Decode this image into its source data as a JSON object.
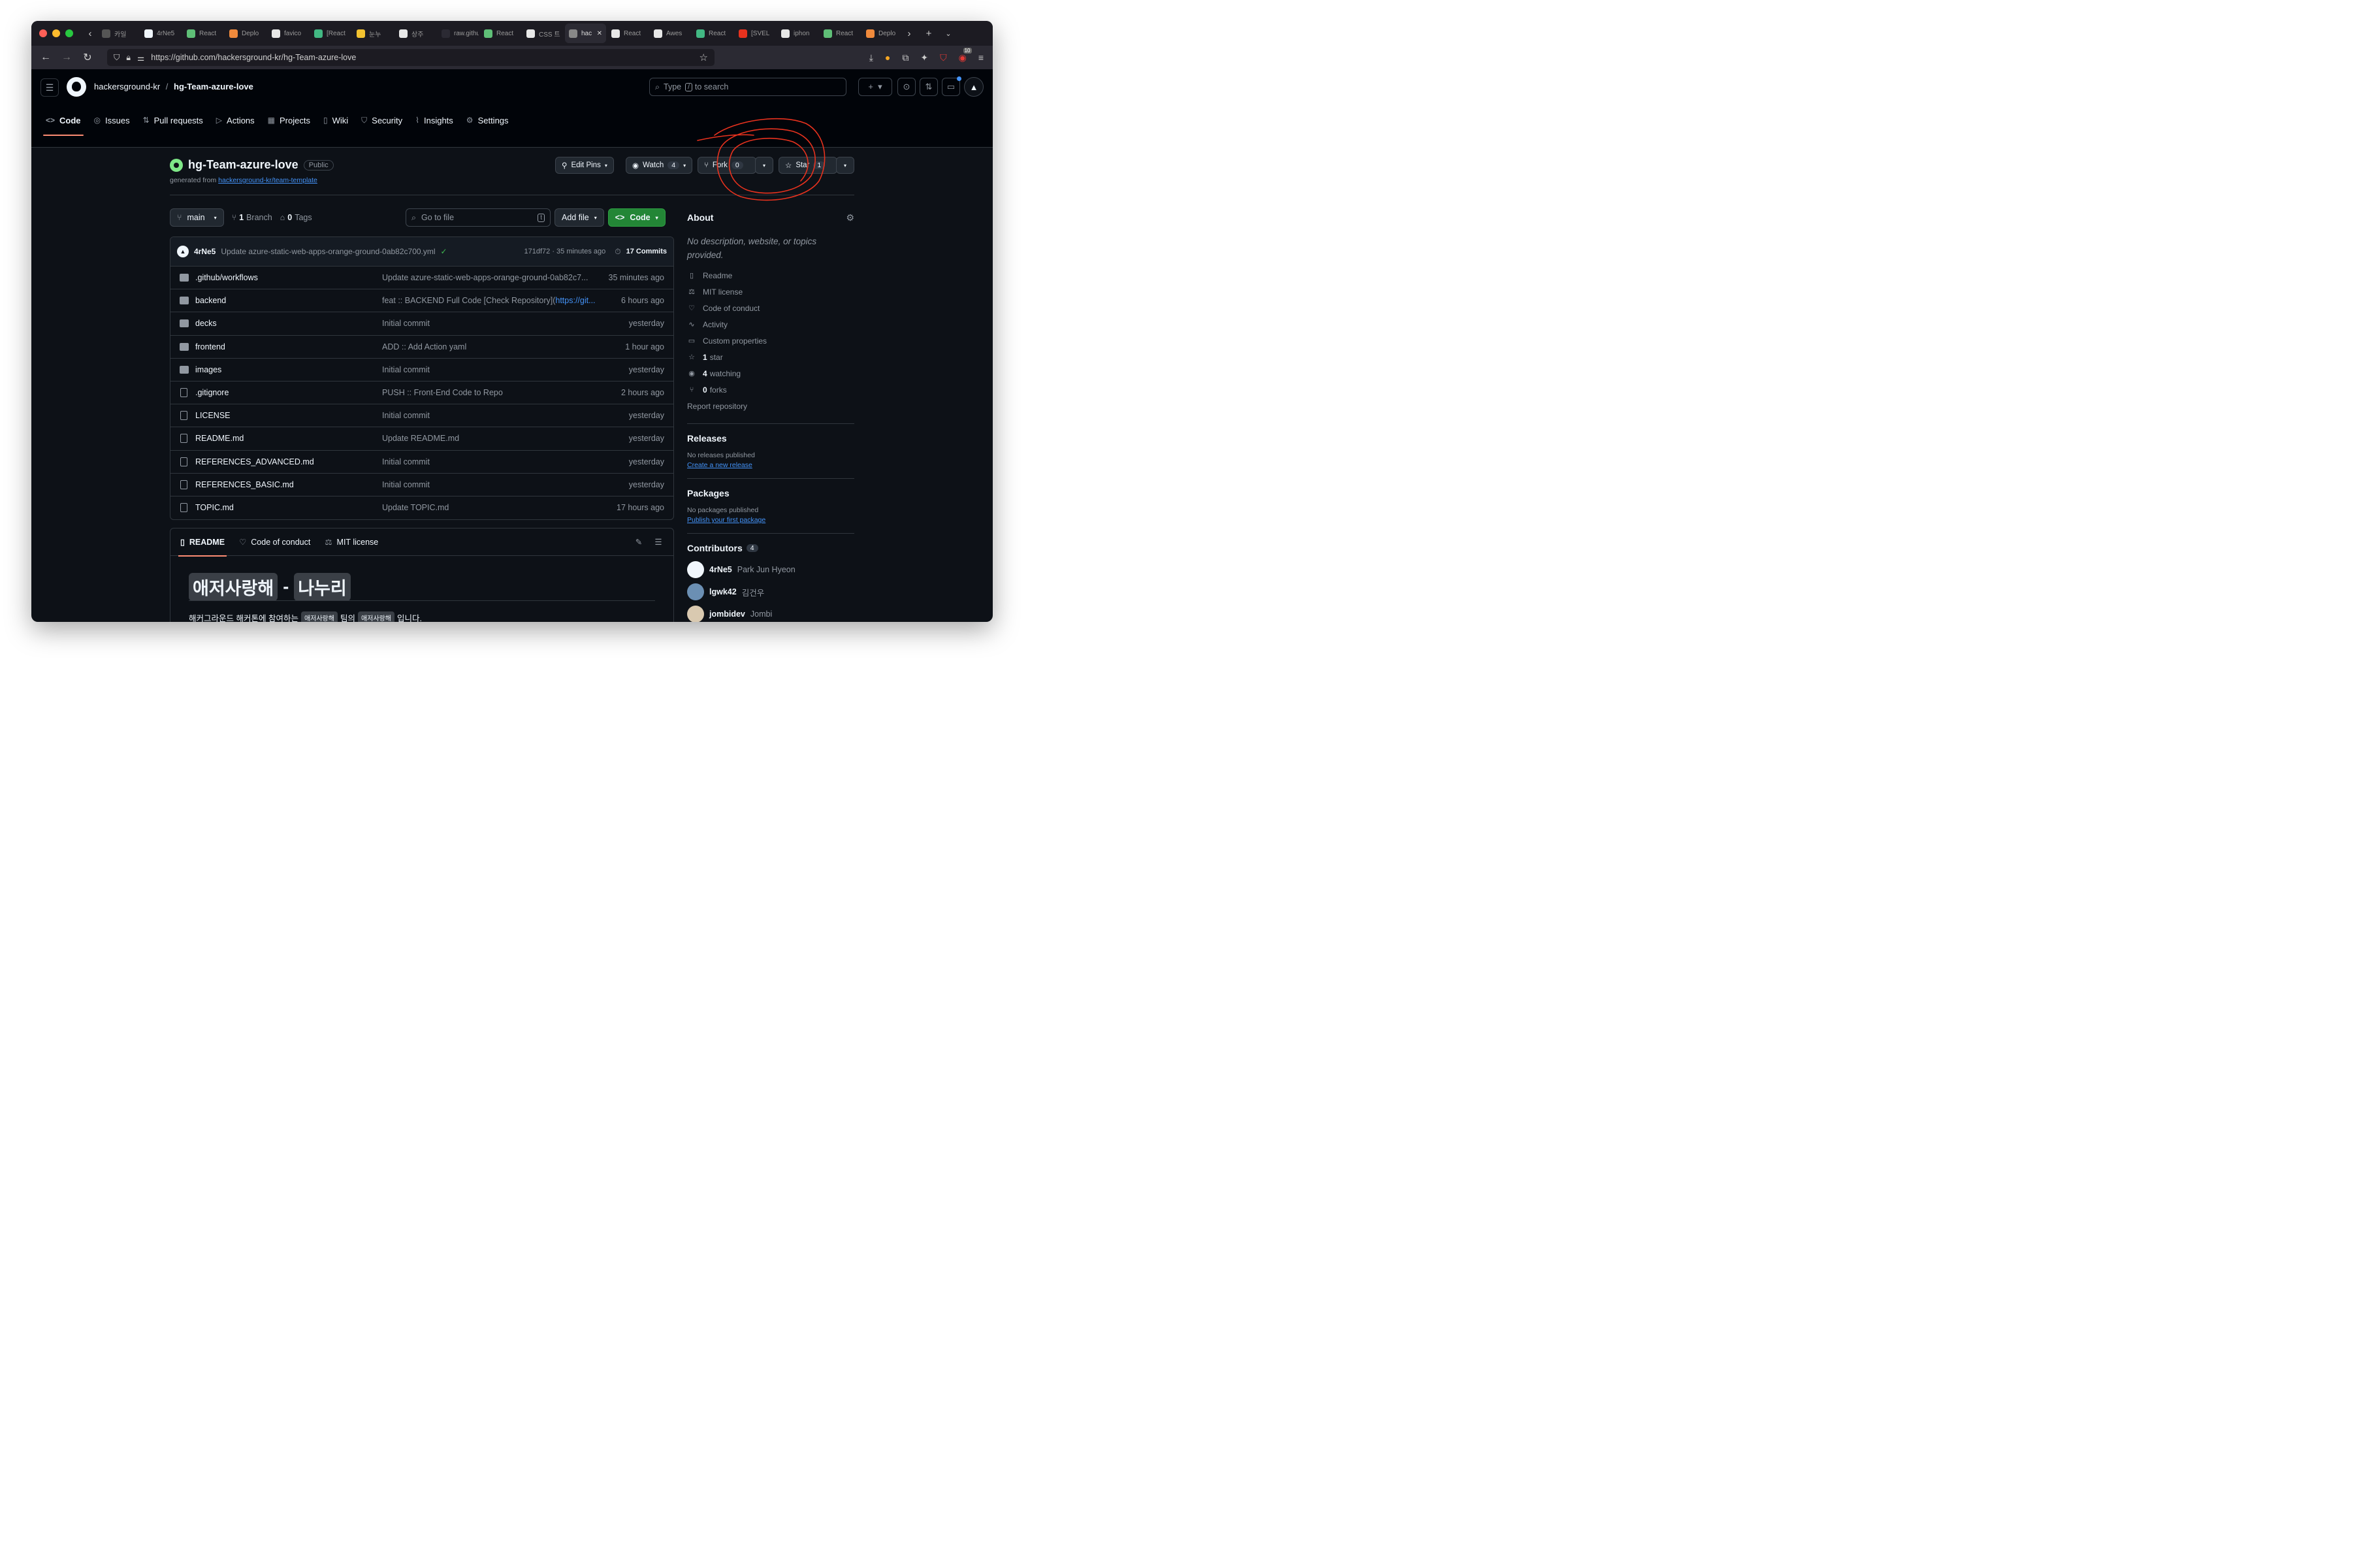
{
  "colors": {
    "accent_green": "#238636",
    "link_blue": "#4493f8",
    "annotation_red": "#e8321e",
    "tab_underline": "#fd8c73"
  },
  "browser": {
    "tabs": [
      {
        "label": "카일",
        "color": "#555"
      },
      {
        "label": "4rNe5",
        "color": "#f0f6fc"
      },
      {
        "label": "React",
        "color": "#5fbf77"
      },
      {
        "label": "Deplo",
        "color": "#f08a3c"
      },
      {
        "label": "favico",
        "color": "#e8e8e8"
      },
      {
        "label": "[React",
        "color": "#42b883"
      },
      {
        "label": "눈누",
        "color": "#f2c230"
      },
      {
        "label": "상주",
        "color": "#e8e8e8"
      },
      {
        "label": "raw.github",
        "color": "#2b2a33"
      },
      {
        "label": "React",
        "color": "#5fbf77"
      },
      {
        "label": "CSS 트",
        "color": "#e8e8e8"
      },
      {
        "label": "hac",
        "color": "#888"
      },
      {
        "label": "React",
        "color": "#e8e8e8"
      },
      {
        "label": "Awes",
        "color": "#e8e8e8"
      },
      {
        "label": "React",
        "color": "#42b883"
      },
      {
        "label": "[SVEL",
        "color": "#e8321e"
      },
      {
        "label": "iphon",
        "color": "#e8e8e8"
      },
      {
        "label": "React",
        "color": "#5fbf77"
      },
      {
        "label": "Deplo",
        "color": "#f08a3c"
      }
    ],
    "url": "https://github.com/hackersground-kr/hg-Team-azure-love",
    "badge_count": "10"
  },
  "header": {
    "owner": "hackersground-kr",
    "separator": "/",
    "repo": "hg-Team-azure-love",
    "search_placeholder": "Type",
    "search_key": "/",
    "search_suffix": "to search"
  },
  "repo_nav": [
    {
      "label": "Code",
      "icon": "<>"
    },
    {
      "label": "Issues",
      "icon": "◎"
    },
    {
      "label": "Pull requests",
      "icon": "⇅"
    },
    {
      "label": "Actions",
      "icon": "▷"
    },
    {
      "label": "Projects",
      "icon": "▦"
    },
    {
      "label": "Wiki",
      "icon": "▯"
    },
    {
      "label": "Security",
      "icon": "⛉"
    },
    {
      "label": "Insights",
      "icon": "⌇"
    },
    {
      "label": "Settings",
      "icon": "⚙"
    }
  ],
  "repo": {
    "name": "hg-Team-azure-love",
    "visibility": "Public",
    "generated_from_prefix": "generated from",
    "generated_from": "hackersground-kr/team-template",
    "edit_pins": "Edit Pins",
    "watch": "Watch",
    "watch_count": "4",
    "fork": "Fork",
    "fork_count": "0",
    "star": "Star",
    "star_count": "1"
  },
  "browser_bar": {
    "branch": "main",
    "branches_count": "1",
    "branches_label": "Branch",
    "tags_count": "0",
    "tags_label": "Tags",
    "go_to_file": "Go to file",
    "go_to_file_key": "t",
    "add_file": "Add file",
    "code": "Code"
  },
  "latest_commit": {
    "author": "4rNe5",
    "message": "Update azure-static-web-apps-orange-ground-0ab82c700.yml",
    "hash_time": "171df72 · 35 minutes ago",
    "commits": "17 Commits"
  },
  "files": [
    {
      "type": "folder",
      "name": ".github/workflows",
      "message": "Update azure-static-web-apps-orange-ground-0ab82c7...",
      "age": "35 minutes ago"
    },
    {
      "type": "folder",
      "name": "backend",
      "message": "feat :: BACKEND Full Code [Check Repository](",
      "message_link": "https://git...",
      "age": "6 hours ago"
    },
    {
      "type": "folder",
      "name": "decks",
      "message": "Initial commit",
      "age": "yesterday"
    },
    {
      "type": "folder",
      "name": "frontend",
      "message": "ADD :: Add Action yaml",
      "age": "1 hour ago"
    },
    {
      "type": "folder",
      "name": "images",
      "message": "Initial commit",
      "age": "yesterday"
    },
    {
      "type": "file",
      "name": ".gitignore",
      "message": "PUSH :: Front-End Code to Repo",
      "age": "2 hours ago"
    },
    {
      "type": "file",
      "name": "LICENSE",
      "message": "Initial commit",
      "age": "yesterday"
    },
    {
      "type": "file",
      "name": "README.md",
      "message": "Update README.md",
      "age": "yesterday"
    },
    {
      "type": "file",
      "name": "REFERENCES_ADVANCED.md",
      "message": "Initial commit",
      "age": "yesterday"
    },
    {
      "type": "file",
      "name": "REFERENCES_BASIC.md",
      "message": "Initial commit",
      "age": "yesterday"
    },
    {
      "type": "file",
      "name": "TOPIC.md",
      "message": "Update TOPIC.md",
      "age": "17 hours ago"
    }
  ],
  "readme": {
    "tabs": [
      "README",
      "Code of conduct",
      "MIT license"
    ],
    "heading_a": "애저사랑해",
    "heading_sep": "-",
    "heading_b": "나누리",
    "text_prefix": "해커그라운드 해커톤에 참여하는",
    "text_code1": "애저사랑해",
    "text_mid": "팀의",
    "text_code2": "애저사랑해",
    "text_suffix": "입니다."
  },
  "about": {
    "title": "About",
    "description": "No description, website, or topics provided.",
    "items": [
      {
        "icon": "book-icon",
        "glyph": "▯",
        "bold": "",
        "label": "Readme"
      },
      {
        "icon": "scale-icon",
        "glyph": "⚖",
        "bold": "",
        "label": "MIT license"
      },
      {
        "icon": "heart-icon",
        "glyph": "♡",
        "bold": "",
        "label": "Code of conduct"
      },
      {
        "icon": "pulse-icon",
        "glyph": "∿",
        "bold": "",
        "label": "Activity"
      },
      {
        "icon": "note-icon",
        "glyph": "▭",
        "bold": "",
        "label": "Custom properties"
      },
      {
        "icon": "star-icon",
        "glyph": "☆",
        "bold": "1",
        "label": "star"
      },
      {
        "icon": "eye-icon",
        "glyph": "◉",
        "bold": "4",
        "label": "watching"
      },
      {
        "icon": "fork-icon",
        "glyph": "⑂",
        "bold": "0",
        "label": "forks"
      }
    ],
    "report": "Report repository"
  },
  "releases": {
    "title": "Releases",
    "none": "No releases published",
    "link": "Create a new release"
  },
  "packages": {
    "title": "Packages",
    "none": "No packages published",
    "link": "Publish your first package"
  },
  "contributors": {
    "title": "Contributors",
    "count": "4",
    "list": [
      {
        "login": "4rNe5",
        "name": "Park Jun Hyeon",
        "color": "#f0f6fc"
      },
      {
        "login": "lgwk42",
        "name": "김건우",
        "color": "#6b8fb3"
      },
      {
        "login": "jombidev",
        "name": "Jombi",
        "color": "#d9c9b0"
      }
    ]
  }
}
